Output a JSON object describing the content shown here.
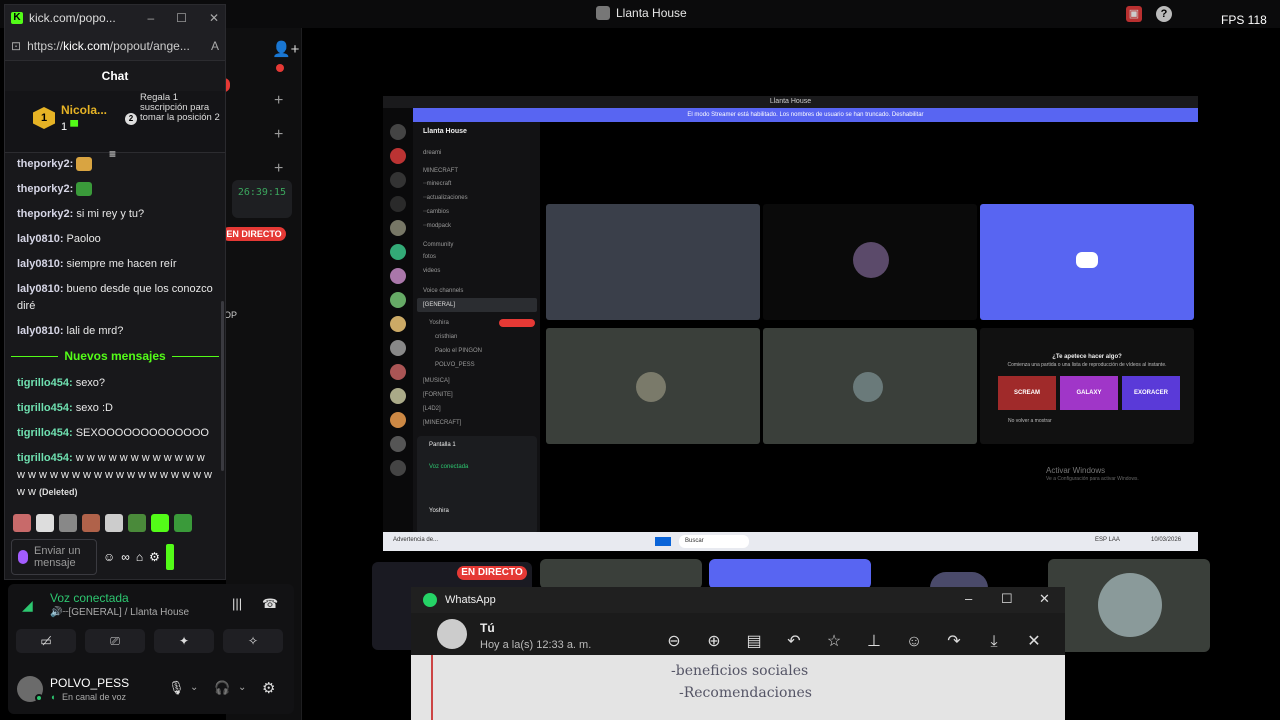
{
  "top_bar": {
    "server_title": "Llanta House",
    "fps": "FPS 118"
  },
  "kick": {
    "window_title": "kick.com/popo...",
    "url_prefix": "https://",
    "url_host": "kick.com",
    "url_rest": "/popout/ange...",
    "chat_header": "Chat",
    "gifter": {
      "rank1_number": "1",
      "rank1_name": "Nicola...",
      "rank1_count": "1",
      "rank2_number": "2",
      "rank2_text": "Regala 1 suscripción para tomar la posición 2"
    },
    "messages": [
      {
        "user": "theporky2:",
        "text": ""
      },
      {
        "user": "theporky2:",
        "text": ""
      },
      {
        "user": "theporky2:",
        "text": "si mi rey y tu?"
      },
      {
        "user": "laly0810:",
        "text": "Paoloo"
      },
      {
        "user": "laly0810:",
        "text": "siempre me hacen reír"
      },
      {
        "user": "laly0810:",
        "text": "bueno desde que los conozco diré"
      },
      {
        "user": "laly0810:",
        "text": "lali de mrd?"
      },
      {
        "user": "tigrillo454:",
        "text": "sexo?"
      },
      {
        "user": "tigrillo454:",
        "text": "sexo :D"
      },
      {
        "user": "tigrillo454:",
        "text": "SEXOOOOOOOOOOOOO"
      },
      {
        "user": "tigrillo454:",
        "text": "w w w w w w w w w w w w w w w w w w w w w w w w w w w w w w w w"
      }
    ],
    "deleted_label": "(Deleted)",
    "new_messages_label": "Nuevos mensajes",
    "chat_input_placeholder": "Enviar un mensaje"
  },
  "discord": {
    "timestamp": "26:39:15",
    "live_badge": "EN DIRECTO",
    "voice": {
      "status": "Voz conectada",
      "channel": "🔊┈[GENERAL] / Llanta House"
    },
    "user": {
      "name": "POLVO_PESS",
      "status": "En canal de voz"
    },
    "side_label": "OP"
  },
  "share": {
    "title": "Llanta House",
    "streamer_banner": "El modo Streamer está habilitado. Los nombres de usuario se han truncado.   Deshabilitar",
    "server_name": "Llanta House",
    "channels": [
      "dreami",
      "MINECRAFT",
      "┈minecraft",
      "┈actualizaciones",
      "┈cambios",
      "┈modpack",
      "Community",
      "fotos",
      "videos",
      "Voice channels",
      "[GENERAL]",
      "Yoshira",
      "cristhian",
      "Paolo el PINGON",
      "POLVO_PESS",
      "[MUSICA]",
      "[FORNITE]",
      "[L4D2]",
      "[MINECRAFT]"
    ],
    "screen_label": "Pantalla 1",
    "voice_status": "Voz conectada",
    "user_name": "Yoshira",
    "activity_title": "¿Te apetece hacer algo?",
    "activity_sub": "Comienza una partida o una lista de reproducción de vídeos al instante.",
    "games": [
      "SCREAM",
      "GALAXY",
      "EXORACER"
    ],
    "dont_show": "No volver a mostrar",
    "watermark_1": "Activar Windows",
    "watermark_2": "Ve a Configuración para activar Windows.",
    "taskbar_search": "Buscar",
    "taskbar_left": "Advertencia de...",
    "taskbar_lang": "ESP LAA",
    "taskbar_time": "10/03/2026"
  },
  "whatsapp": {
    "app_name": "WhatsApp",
    "contact": "Tú",
    "timestamp": "Hoy a la(s) 12:33 a. m.",
    "image_text_1": "-beneficios sociales",
    "image_text_2": "-Recomendaciones"
  },
  "colors": {
    "kick_green": "#53fc18",
    "live_red": "#e53935",
    "discord_blurple": "#5865f2",
    "voice_green": "#2dc770"
  }
}
